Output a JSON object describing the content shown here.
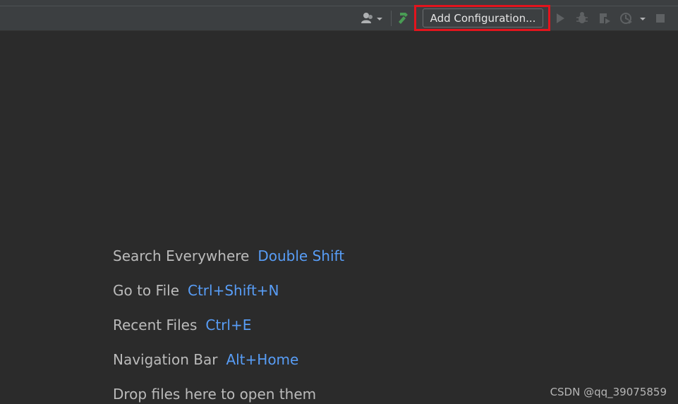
{
  "toolbar": {
    "config_label": "Add Configuration...",
    "icons": [
      "user-icon",
      "chevron-down-icon",
      "build-hammer-icon",
      "run-icon",
      "debug-bug-icon",
      "coverage-icon",
      "profile-icon",
      "chevron-down-icon",
      "stop-icon"
    ]
  },
  "hints": [
    {
      "label": "Search Everywhere",
      "shortcut": "Double Shift"
    },
    {
      "label": "Go to File",
      "shortcut": "Ctrl+Shift+N"
    },
    {
      "label": "Recent Files",
      "shortcut": "Ctrl+E"
    },
    {
      "label": "Navigation Bar",
      "shortcut": "Alt+Home"
    },
    {
      "label": "Drop files here to open them",
      "shortcut": ""
    }
  ],
  "watermark": "CSDN @qq_39075859",
  "colors": {
    "background": "#2b2b2b",
    "toolbar": "#3c3f41",
    "shortcut_accent": "#589df6",
    "highlight_red": "#e3141d",
    "build_green": "#499c54"
  }
}
